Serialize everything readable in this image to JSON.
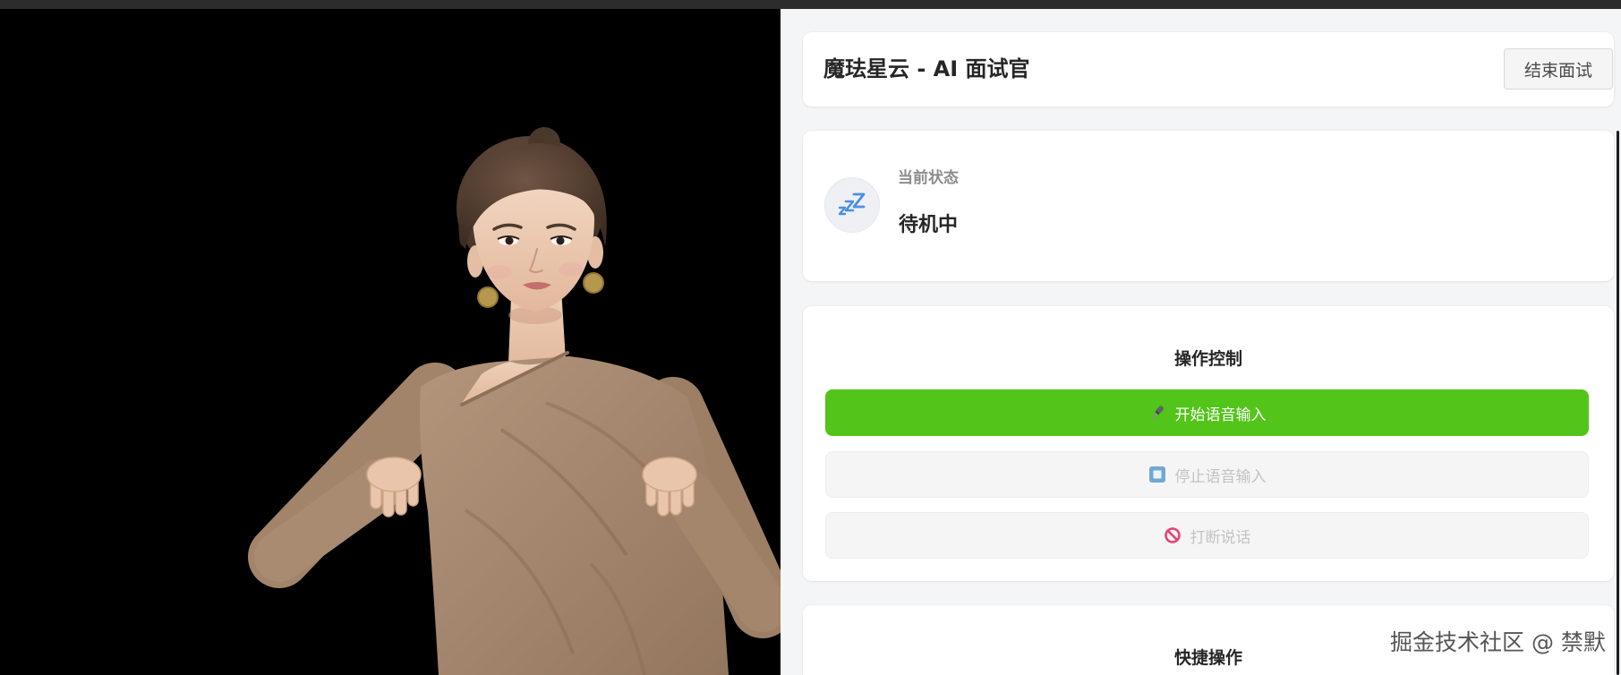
{
  "header": {
    "title": "魔珐星云 - AI 面试官",
    "end_button_label": "结束面试"
  },
  "status": {
    "label": "当前状态",
    "value": "待机中",
    "icon": "sleep-zzz-icon"
  },
  "controls": {
    "title": "操作控制",
    "buttons": [
      {
        "label": "开始语音输入",
        "icon": "microphone-icon",
        "disabled": false
      },
      {
        "label": "停止语音输入",
        "icon": "stop-square-icon",
        "disabled": true
      },
      {
        "label": "打断说话",
        "icon": "prohibited-icon",
        "disabled": true
      }
    ]
  },
  "quick_actions": {
    "title": "快捷操作"
  },
  "watermark": "掘金技术社区 @ 禁默",
  "colors": {
    "primary": "#52c41a",
    "status-icon": "#4a90e2",
    "stop-icon": "#5b9bd5",
    "interrupt-icon": "#e0245e"
  }
}
